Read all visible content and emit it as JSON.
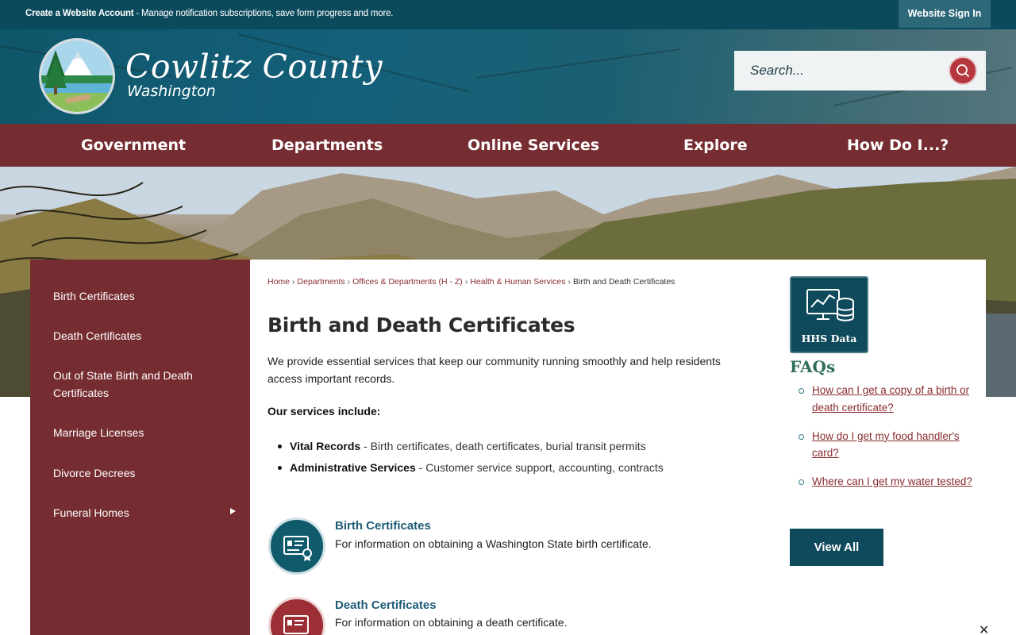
{
  "topbar": {
    "create_account": "Create a Website Account",
    "message": " - Manage notification subscriptions, save form progress and more.",
    "signin_label": "Website Sign In"
  },
  "header": {
    "brand_name": "Cowlitz County",
    "brand_sub": "Washington",
    "search_placeholder": "Search..."
  },
  "nav": {
    "items": [
      "Government",
      "Departments",
      "Online Services",
      "Explore",
      "How Do I...?"
    ]
  },
  "sidebar": {
    "items": [
      "Birth Certificates",
      "Death Certificates",
      "Out of State Birth and Death Certificates",
      "Marriage Licenses",
      "Divorce Decrees",
      "Funeral Homes"
    ]
  },
  "breadcrumb": {
    "items": [
      "Home",
      "Departments",
      "Offices & Departments (H - Z)",
      "Health & Human Services"
    ],
    "current": "Birth and Death Certificates"
  },
  "main": {
    "title": "Birth and Death Certificates",
    "intro": "We provide essential services that keep our community running smoothly and help residents access important records.",
    "services_heading": "Our services include:",
    "services": [
      {
        "name": "Vital Records",
        "desc": " - Birth certificates, death certificates, burial transit permits"
      },
      {
        "name": "Administrative Services",
        "desc": " - Customer service support, accounting, contracts"
      }
    ],
    "cards": [
      {
        "title": "Birth Certificates",
        "desc": "For information on obtaining a Washington State birth certificate.",
        "icon": "certificate-icon",
        "color": "#0f5a6b"
      },
      {
        "title": "Death Certificates",
        "desc": "For information on obtaining a death certificate.",
        "icon": "certificate-icon",
        "color": "#9b2f35"
      }
    ]
  },
  "right": {
    "tile_label": "HHS Data",
    "faq_title": "FAQs",
    "faqs": [
      "How can I get a copy of a birth or death certificate?",
      "How do I get my food handler's card?",
      "Where can I get my water tested?"
    ],
    "view_all": "View All"
  },
  "colors": {
    "teal": "#0f4a5c",
    "maroon": "#762d31",
    "link": "#8b2c30",
    "faq_heading": "#2f6e5a"
  }
}
